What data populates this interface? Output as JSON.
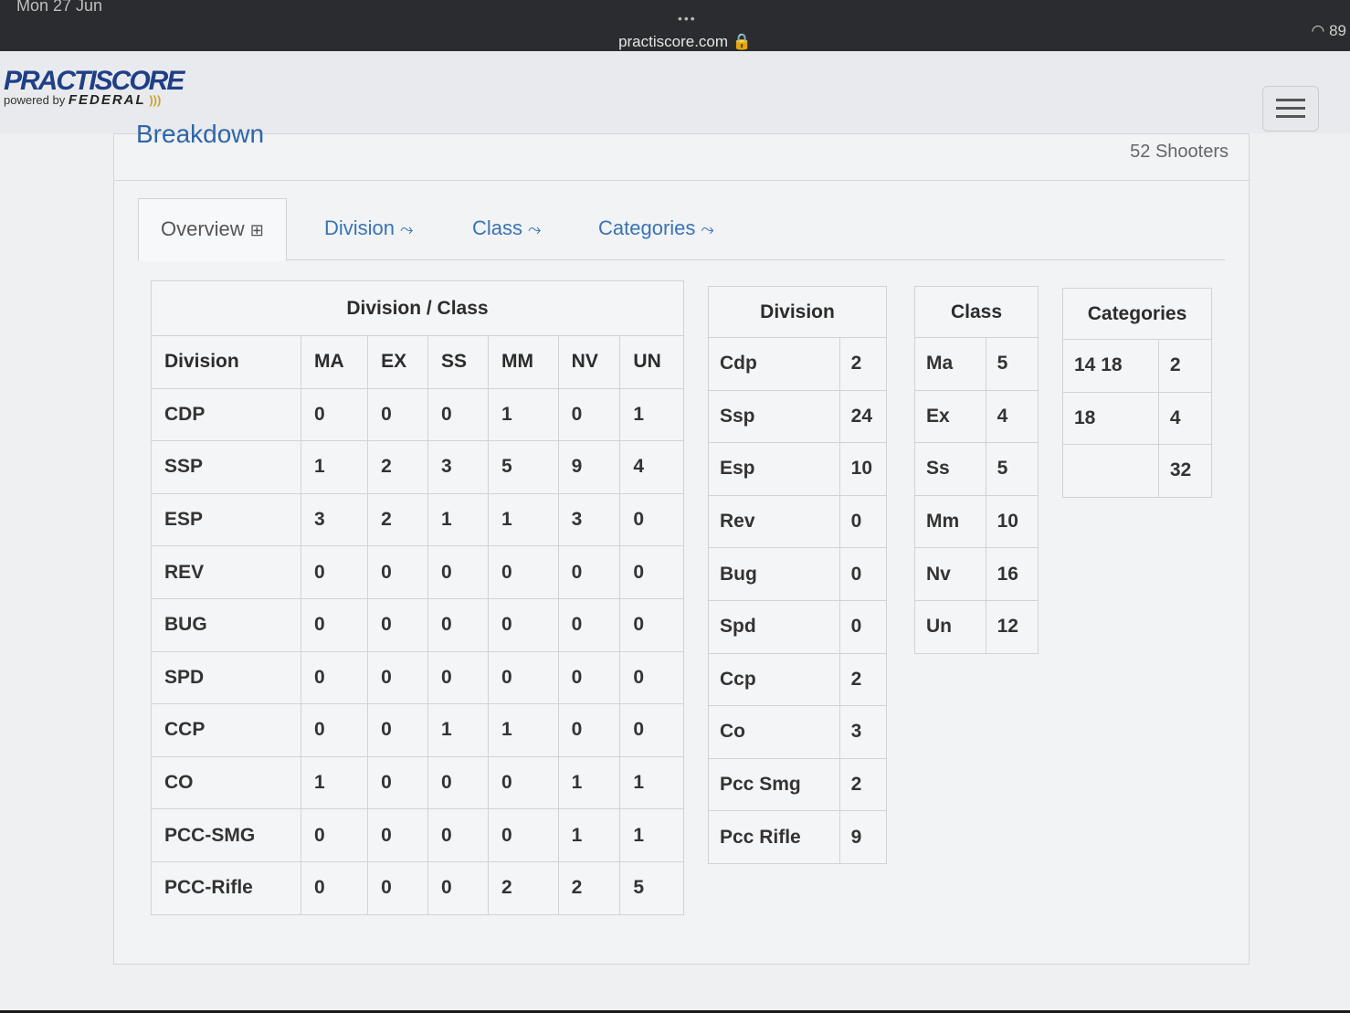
{
  "status_bar": {
    "time": "Mon 27 Jun",
    "dots": "•••",
    "url": "practiscore.com 🔒",
    "wifi": "◠ 89"
  },
  "logo": {
    "main": "PRACTISCORE",
    "powered": "powered by",
    "brand": "FEDERAL",
    "arc": ")))"
  },
  "panel": {
    "heading": "Breakdown",
    "shooters": "52 Shooters"
  },
  "tabs": [
    {
      "label": "Overview",
      "icon": "⊞"
    },
    {
      "label": "Division",
      "icon": "⤳"
    },
    {
      "label": "Class",
      "icon": "⤳"
    },
    {
      "label": "Categories",
      "icon": "⤳"
    }
  ],
  "division_class": {
    "caption": "Division / Class",
    "headers": [
      "Division",
      "MA",
      "EX",
      "SS",
      "MM",
      "NV",
      "UN"
    ],
    "rows": [
      [
        "CDP",
        "0",
        "0",
        "0",
        "1",
        "0",
        "1"
      ],
      [
        "SSP",
        "1",
        "2",
        "3",
        "5",
        "9",
        "4"
      ],
      [
        "ESP",
        "3",
        "2",
        "1",
        "1",
        "3",
        "0"
      ],
      [
        "REV",
        "0",
        "0",
        "0",
        "0",
        "0",
        "0"
      ],
      [
        "BUG",
        "0",
        "0",
        "0",
        "0",
        "0",
        "0"
      ],
      [
        "SPD",
        "0",
        "0",
        "0",
        "0",
        "0",
        "0"
      ],
      [
        "CCP",
        "0",
        "0",
        "1",
        "1",
        "0",
        "0"
      ],
      [
        "CO",
        "1",
        "0",
        "0",
        "0",
        "1",
        "1"
      ],
      [
        "PCC-SMG",
        "0",
        "0",
        "0",
        "0",
        "1",
        "1"
      ],
      [
        "PCC-Rifle",
        "0",
        "0",
        "0",
        "2",
        "2",
        "5"
      ]
    ]
  },
  "division": {
    "caption": "Division",
    "rows": [
      [
        "Cdp",
        "2"
      ],
      [
        "Ssp",
        "24"
      ],
      [
        "Esp",
        "10"
      ],
      [
        "Rev",
        "0"
      ],
      [
        "Bug",
        "0"
      ],
      [
        "Spd",
        "0"
      ],
      [
        "Ccp",
        "2"
      ],
      [
        "Co",
        "3"
      ],
      [
        "Pcc Smg",
        "2"
      ],
      [
        "Pcc Rifle",
        "9"
      ]
    ]
  },
  "class": {
    "caption": "Class",
    "rows": [
      [
        "Ma",
        "5"
      ],
      [
        "Ex",
        "4"
      ],
      [
        "Ss",
        "5"
      ],
      [
        "Mm",
        "10"
      ],
      [
        "Nv",
        "16"
      ],
      [
        "Un",
        "12"
      ]
    ]
  },
  "categories": {
    "caption": "Categories",
    "rows": [
      [
        "14 18",
        "2"
      ],
      [
        "18",
        "4"
      ],
      [
        "",
        "32"
      ]
    ]
  }
}
